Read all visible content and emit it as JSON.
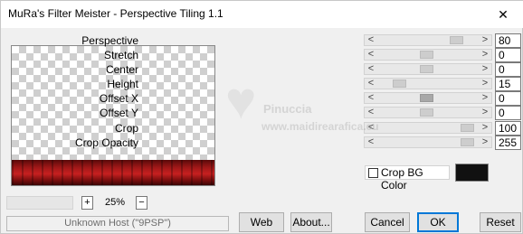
{
  "window": {
    "title": "MuRa's Filter Meister - Perspective Tiling 1.1",
    "close_glyph": "✕"
  },
  "zoom": {
    "plus": "+",
    "minus": "−",
    "value": "25%"
  },
  "host": {
    "text": "Unknown Host (\"9PSP\")"
  },
  "params": [
    {
      "label": "Perspective",
      "value": "80"
    },
    {
      "label": "Stretch",
      "value": "0"
    },
    {
      "label": "Center",
      "value": "0"
    },
    {
      "label": "Height",
      "value": "15"
    },
    {
      "label": "Offset X",
      "value": "0"
    },
    {
      "label": "Offset Y",
      "value": "0"
    },
    {
      "label": "Crop",
      "value": "100"
    },
    {
      "label": "Crop Opacity",
      "value": "255"
    }
  ],
  "slider_arrows": {
    "left": "<",
    "right": ">"
  },
  "crop_bg": {
    "label": "Crop BG Color",
    "checked": false,
    "color": "#111111"
  },
  "buttons": {
    "web": "Web",
    "about": "About...",
    "cancel": "Cancel",
    "ok": "OK",
    "reset": "Reset"
  },
  "watermark": {
    "heart_glyph": "♥",
    "name": "Pinuccia",
    "url": "www.maidirearafica.eu"
  }
}
